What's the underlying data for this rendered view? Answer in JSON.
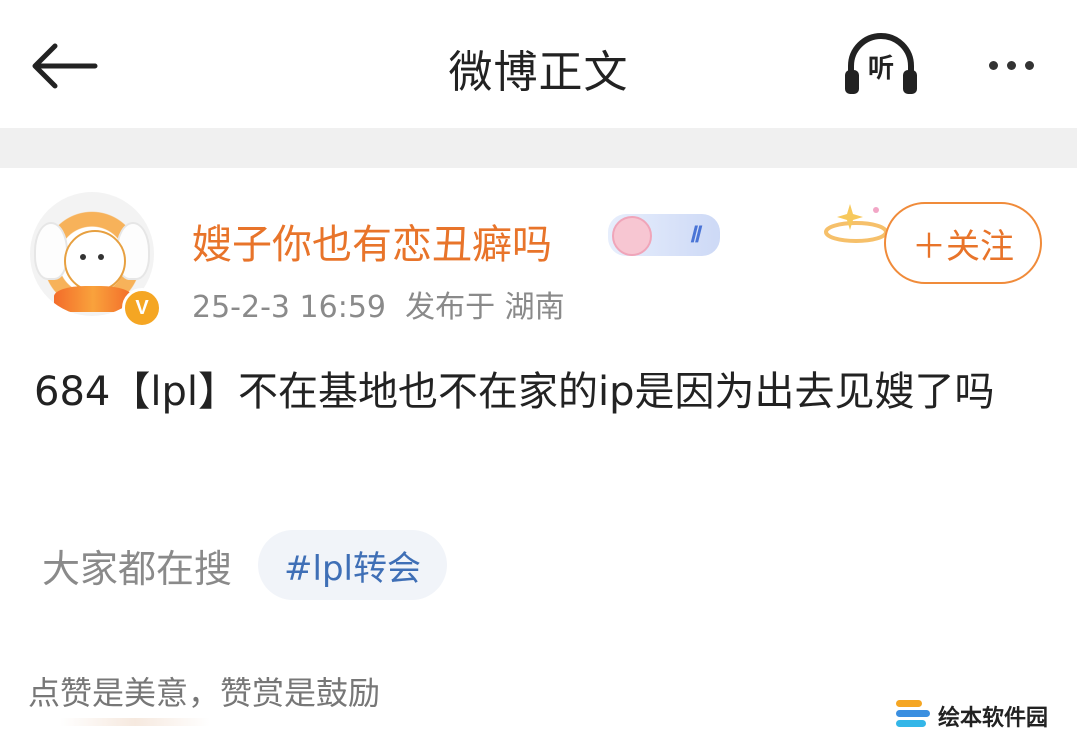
{
  "header": {
    "title": "微博正文",
    "listen_label": "听"
  },
  "post": {
    "username": "嫂子你也有恋丑癖吗",
    "member_level": "Ⅱ",
    "verified_mark": "V",
    "timestamp": "25-2-3 16:59",
    "published_from": "发布于 湖南",
    "follow_label": "＋关注",
    "content": "684【lpl】不在基地也不在家的ip是因为出去见嫂了吗"
  },
  "search": {
    "label": "大家都在搜",
    "hashtag": "#lpl转会"
  },
  "footer": {
    "like_note": "点赞是美意，赞赏是鼓励"
  },
  "watermark": {
    "text": "绘本软件园"
  },
  "colors": {
    "accent": "#e8742a",
    "link": "#3f6fb6",
    "muted": "#8a8a8a",
    "separator": "#f0f0f0"
  }
}
